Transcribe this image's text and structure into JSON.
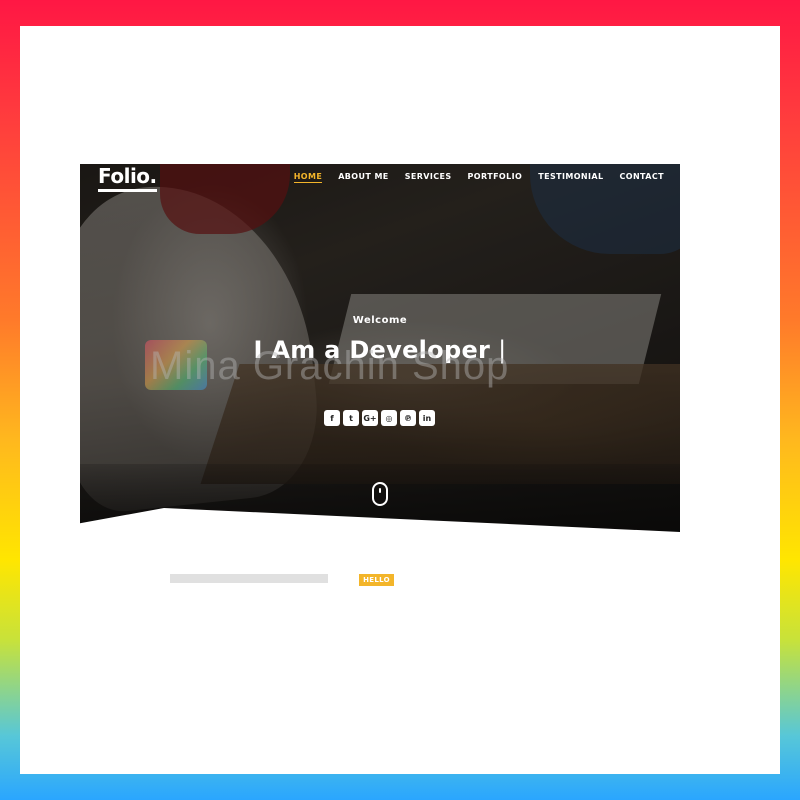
{
  "navbar": {
    "logo": "Folio.",
    "items": [
      {
        "label": "HOME",
        "active": true
      },
      {
        "label": "ABOUT ME"
      },
      {
        "label": "SERVICES"
      },
      {
        "label": "PORTFOLIO"
      },
      {
        "label": "TESTIMONIAL"
      },
      {
        "label": "CONTACT"
      }
    ]
  },
  "hero": {
    "welcome": "Welcome",
    "headline": "I Am a Developer",
    "cursor": "|",
    "socials": [
      {
        "icon": "facebook-icon",
        "glyph": "f"
      },
      {
        "icon": "twitter-icon",
        "glyph": "t"
      },
      {
        "icon": "google-plus-icon",
        "glyph": "G+"
      },
      {
        "icon": "instagram-icon",
        "glyph": "◎"
      },
      {
        "icon": "pinterest-icon",
        "glyph": "℗"
      },
      {
        "icon": "linkedin-icon",
        "glyph": "in"
      }
    ]
  },
  "watermark": "Mina Grachin Shop",
  "about": {
    "badge": "HELLO"
  },
  "colors": {
    "accent": "#f3b52a",
    "frame": "#ffffff"
  }
}
